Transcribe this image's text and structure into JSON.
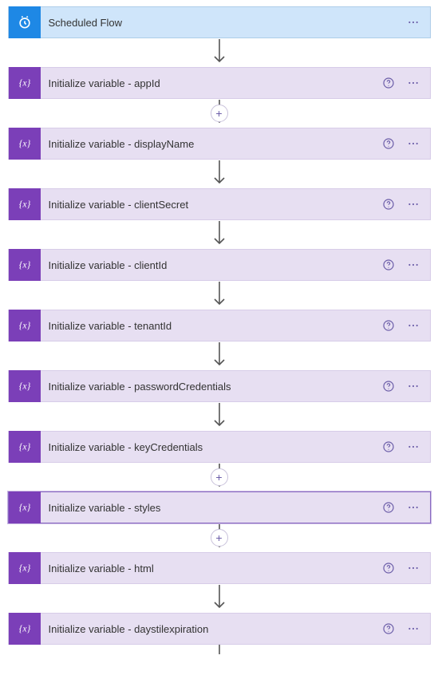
{
  "colors": {
    "trigger_bg": "#cfe5fa",
    "trigger_icon": "#1e88e5",
    "action_bg": "#e7dff2",
    "action_icon": "#7b3fb8",
    "accent": "#6b5da8"
  },
  "steps": [
    {
      "kind": "trigger",
      "label": "Scheduled Flow",
      "help": false,
      "plus_after": false,
      "selected": false
    },
    {
      "kind": "action",
      "label": "Initialize variable - appId",
      "help": true,
      "plus_after": true,
      "selected": false
    },
    {
      "kind": "action",
      "label": "Initialize variable - displayName",
      "help": true,
      "plus_after": false,
      "selected": false
    },
    {
      "kind": "action",
      "label": "Initialize variable - clientSecret",
      "help": true,
      "plus_after": false,
      "selected": false
    },
    {
      "kind": "action",
      "label": "Initialize variable - clientId",
      "help": true,
      "plus_after": false,
      "selected": false
    },
    {
      "kind": "action",
      "label": "Initialize variable - tenantId",
      "help": true,
      "plus_after": false,
      "selected": false
    },
    {
      "kind": "action",
      "label": "Initialize variable - passwordCredentials",
      "help": true,
      "plus_after": false,
      "selected": false
    },
    {
      "kind": "action",
      "label": "Initialize variable - keyCredentials",
      "help": true,
      "plus_after": true,
      "selected": false
    },
    {
      "kind": "action",
      "label": "Initialize variable - styles",
      "help": true,
      "plus_after": true,
      "selected": true
    },
    {
      "kind": "action",
      "label": "Initialize variable - html",
      "help": true,
      "plus_after": false,
      "selected": false
    },
    {
      "kind": "action",
      "label": "Initialize variable - daystilexpiration",
      "help": true,
      "plus_after": false,
      "selected": false
    }
  ]
}
